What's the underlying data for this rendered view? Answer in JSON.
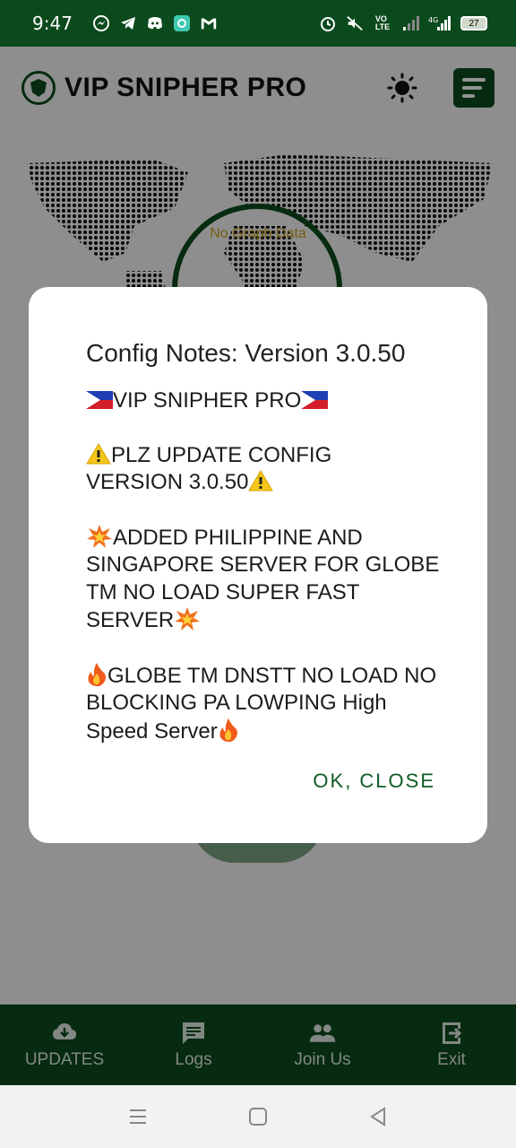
{
  "status_bar": {
    "time": "9:47",
    "battery": "27",
    "network": "4G"
  },
  "app": {
    "title": "VIP SNIPHER PRO",
    "graph_placeholder": "No Graph Data",
    "accent_color": "#0b4a1c"
  },
  "dialog": {
    "title": "Config Notes: Version 3.0.50",
    "line1": "VIP SNIPHER PRO",
    "line2a": "PLZ UPDATE CONFIG",
    "line2b": "VERSION 3.0.50",
    "line3": "ADDED PHILIPPINE AND SINGAPORE SERVER FOR GLOBE TM NO LOAD SUPER FAST SERVER",
    "line4": "GLOBE TM DNSTT NO LOAD NO BLOCKING PA LOWPING High Speed Server",
    "ok_label": "OK, CLOSE"
  },
  "bottom_nav": [
    {
      "label": "UPDATES",
      "icon": "cloud-download-icon"
    },
    {
      "label": "Logs",
      "icon": "chat-icon"
    },
    {
      "label": "Join Us",
      "icon": "people-icon"
    },
    {
      "label": "Exit",
      "icon": "exit-icon"
    }
  ]
}
